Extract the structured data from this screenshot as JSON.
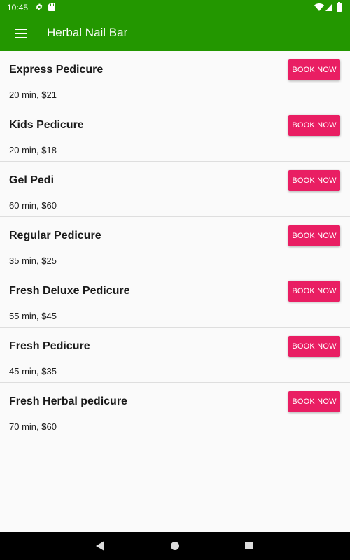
{
  "status_bar": {
    "time": "10:45",
    "icons": [
      "settings-gear-icon",
      "sd-card-icon",
      "wifi-icon",
      "cell-signal-icon",
      "battery-icon"
    ]
  },
  "app_bar": {
    "title": "Herbal Nail Bar",
    "menu_icon": "hamburger-menu-icon",
    "background_color": "#239700"
  },
  "services": [
    {
      "name": "Express Pedicure",
      "details": "20 min, $21",
      "button_label": "BOOK NOW"
    },
    {
      "name": "Kids Pedicure",
      "details": "20 min, $18",
      "button_label": "BOOK NOW"
    },
    {
      "name": "Gel Pedi",
      "details": "60 min, $60",
      "button_label": "BOOK NOW"
    },
    {
      "name": "Regular Pedicure",
      "details": "35 min, $25",
      "button_label": "BOOK NOW"
    },
    {
      "name": "Fresh Deluxe Pedicure",
      "details": "55 min, $45",
      "button_label": "BOOK NOW"
    },
    {
      "name": "Fresh Pedicure",
      "details": "45 min, $35",
      "button_label": "BOOK NOW"
    },
    {
      "name": "Fresh Herbal pedicure",
      "details": "70 min, $60",
      "button_label": "BOOK NOW"
    }
  ],
  "colors": {
    "accent": "#e91e63",
    "primary": "#239700"
  },
  "nav_bar": {
    "icons": [
      "back-icon",
      "home-icon",
      "recents-icon"
    ]
  }
}
